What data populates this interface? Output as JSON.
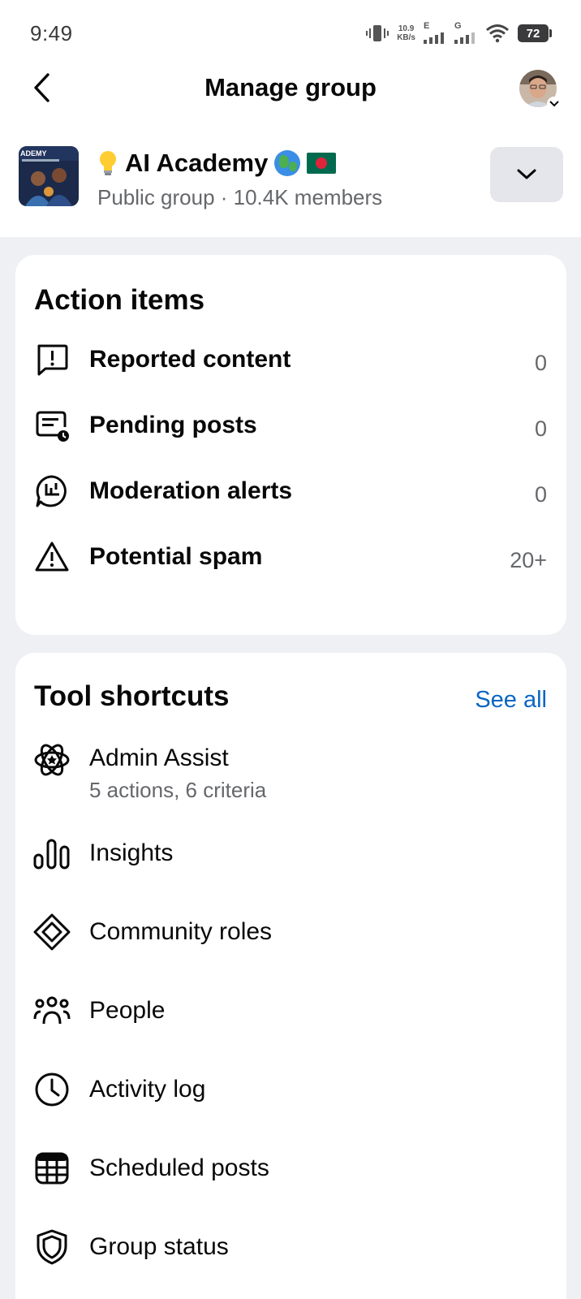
{
  "status_bar": {
    "time": "9:49",
    "net_speed_value": "10.9",
    "net_speed_unit": "KB/s",
    "sim1_label": "E",
    "sim2_label": "G",
    "battery": "72"
  },
  "header": {
    "title": "Manage group"
  },
  "group": {
    "name": "AI Academy",
    "meta": "Public group · 10.4K members",
    "thumb_text": "ADEMY"
  },
  "action_items": {
    "title": "Action items",
    "items": [
      {
        "label": "Reported content",
        "count": "0",
        "icon": "report-bubble-icon"
      },
      {
        "label": "Pending posts",
        "count": "0",
        "icon": "pending-posts-icon"
      },
      {
        "label": "Moderation alerts",
        "count": "0",
        "icon": "moderation-alert-icon"
      },
      {
        "label": "Potential spam",
        "count": "20+",
        "icon": "warning-triangle-icon"
      }
    ]
  },
  "tool_shortcuts": {
    "title": "Tool shortcuts",
    "see_all": "See all",
    "items": [
      {
        "label": "Admin Assist",
        "sub": "5 actions, 6 criteria",
        "icon": "admin-assist-icon"
      },
      {
        "label": "Insights",
        "icon": "insights-icon"
      },
      {
        "label": "Community roles",
        "icon": "community-roles-icon"
      },
      {
        "label": "People",
        "icon": "people-icon"
      },
      {
        "label": "Activity log",
        "icon": "clock-icon"
      },
      {
        "label": "Scheduled posts",
        "icon": "calendar-icon"
      },
      {
        "label": "Group status",
        "icon": "shield-icon"
      }
    ]
  },
  "colors": {
    "link": "#0a66c2",
    "secondary_text": "#65676b",
    "background": "#eef0f3"
  }
}
